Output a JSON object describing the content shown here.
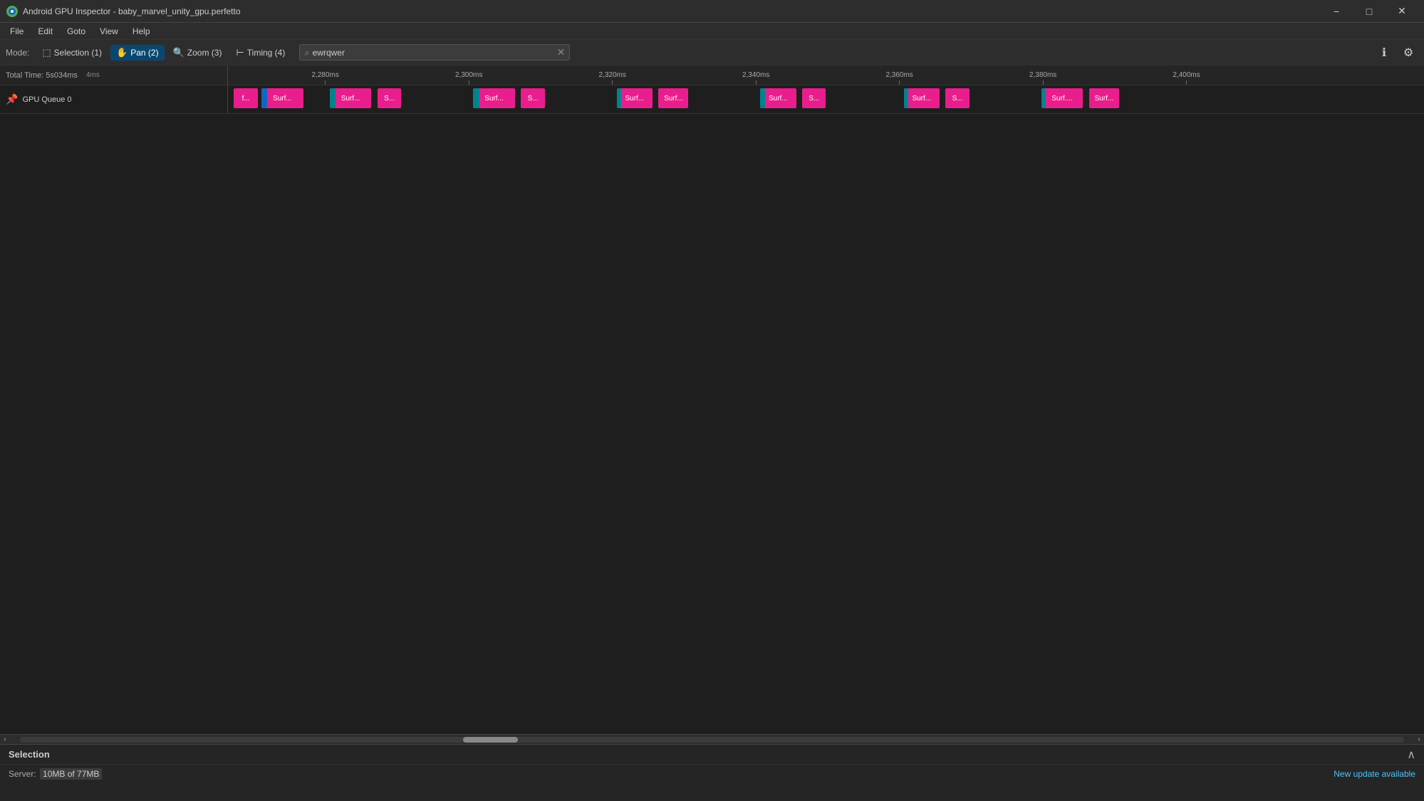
{
  "window": {
    "title": "Android GPU Inspector - baby_marvel_unity_gpu.perfetto",
    "minimize_label": "−",
    "maximize_label": "□",
    "close_label": "✕"
  },
  "menubar": {
    "items": [
      "File",
      "Edit",
      "Goto",
      "View",
      "Help"
    ]
  },
  "toolbar": {
    "mode_label": "Mode:",
    "modes": [
      {
        "id": "selection",
        "label": "Selection (1)",
        "shortcut": "1",
        "active": false
      },
      {
        "id": "pan",
        "label": "Pan (2)",
        "shortcut": "2",
        "active": true
      },
      {
        "id": "zoom",
        "label": "Zoom (3)",
        "shortcut": "3",
        "active": false
      },
      {
        "id": "timing",
        "label": "Timing (4)",
        "shortcut": "4",
        "active": false
      }
    ],
    "search_placeholder": "ewrqwer",
    "search_value": "ewrqwer"
  },
  "timeline": {
    "total_time": "Total Time: 5s034ms",
    "scale_indicator": "4ms",
    "ruler_ticks": [
      {
        "label": "2,280ms",
        "pct": 7
      },
      {
        "label": "2,300ms",
        "pct": 19
      },
      {
        "label": "2,320ms",
        "pct": 31
      },
      {
        "label": "2,340ms",
        "pct": 43
      },
      {
        "label": "2,360ms",
        "pct": 55
      },
      {
        "label": "2,380ms",
        "pct": 67
      },
      {
        "label": "2,400ms",
        "pct": 79
      }
    ],
    "tracks": [
      {
        "id": "gpu-queue-0",
        "label": "GPU Queue 0",
        "blocks": [
          {
            "label": "f...",
            "left_pct": 0.5,
            "width_pct": 2.0,
            "color": "pink"
          },
          {
            "label": "Surf...",
            "left_pct": 2.8,
            "width_pct": 3.5,
            "color": "pink"
          },
          {
            "label": "",
            "left_pct": 2.8,
            "width_pct": 0.5,
            "color": "blue"
          },
          {
            "label": "Surf...",
            "left_pct": 8.5,
            "width_pct": 3.5,
            "color": "pink"
          },
          {
            "label": "S...",
            "left_pct": 12.5,
            "width_pct": 2.0,
            "color": "pink"
          },
          {
            "label": "",
            "left_pct": 8.5,
            "width_pct": 0.5,
            "color": "teal"
          },
          {
            "label": "Surf...",
            "left_pct": 20.5,
            "width_pct": 3.5,
            "color": "pink"
          },
          {
            "label": "S...",
            "left_pct": 24.5,
            "width_pct": 2.0,
            "color": "pink"
          },
          {
            "label": "",
            "left_pct": 20.5,
            "width_pct": 0.5,
            "color": "teal"
          },
          {
            "label": "Surf...",
            "left_pct": 32.5,
            "width_pct": 3.0,
            "color": "pink"
          },
          {
            "label": "Surf...",
            "left_pct": 36.0,
            "width_pct": 2.5,
            "color": "pink"
          },
          {
            "label": "",
            "left_pct": 32.5,
            "width_pct": 0.4,
            "color": "teal"
          },
          {
            "label": "Surf...",
            "left_pct": 44.5,
            "width_pct": 3.0,
            "color": "pink"
          },
          {
            "label": "S...",
            "left_pct": 48.0,
            "width_pct": 2.0,
            "color": "pink"
          },
          {
            "label": "",
            "left_pct": 44.5,
            "width_pct": 0.4,
            "color": "teal"
          },
          {
            "label": "Surf...",
            "left_pct": 56.5,
            "width_pct": 3.0,
            "color": "pink"
          },
          {
            "label": "S...",
            "left_pct": 60.0,
            "width_pct": 2.0,
            "color": "pink"
          },
          {
            "label": "",
            "left_pct": 56.5,
            "width_pct": 0.4,
            "color": "teal"
          },
          {
            "label": "Surf....",
            "left_pct": 68.0,
            "width_pct": 3.5,
            "color": "pink"
          },
          {
            "label": "Surf...",
            "left_pct": 72.0,
            "width_pct": 2.5,
            "color": "pink"
          },
          {
            "label": "",
            "left_pct": 68.0,
            "width_pct": 0.4,
            "color": "teal"
          }
        ]
      }
    ]
  },
  "scrollbar": {
    "thumb_left_pct": 32,
    "thumb_width_pct": 4
  },
  "bottom_panel": {
    "title": "Selection",
    "collapse_icon": "∧",
    "server_label": "Server:",
    "server_value": "10MB of 77MB",
    "update_text": "New update available"
  }
}
